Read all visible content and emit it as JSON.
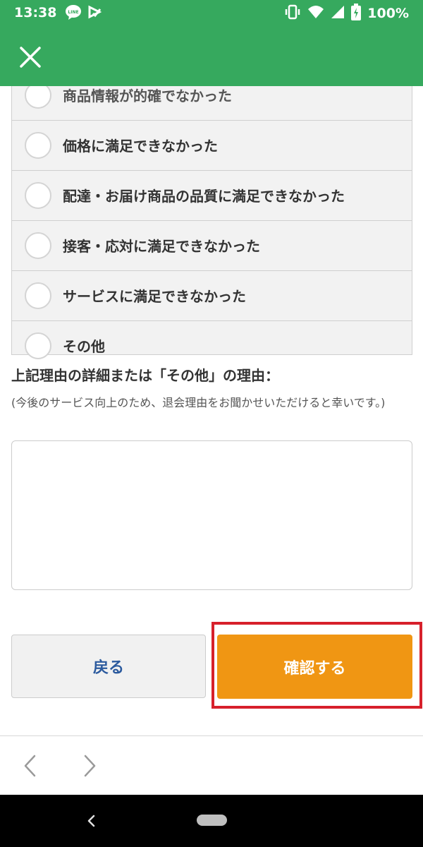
{
  "status_bar": {
    "time": "13:38",
    "battery": "100%",
    "icons": [
      "line-icon",
      "tick-icon",
      "vibrate-icon",
      "wifi-icon",
      "signal-icon",
      "battery-icon"
    ]
  },
  "header": {
    "close_icon": "close-icon",
    "background_color": "#36a95e"
  },
  "form": {
    "options": [
      {
        "label": "商品情報が的確でなかった"
      },
      {
        "label": "価格に満足できなかった"
      },
      {
        "label": "配達・お届け商品の品質に満足できなかった"
      },
      {
        "label": "接客・応対に満足できなかった"
      },
      {
        "label": "サービスに満足できなかった"
      },
      {
        "label": "その他"
      }
    ],
    "detail_heading": "上記理由の詳細または「その他」の理由：",
    "detail_note": "(今後のサービス向上のため、退会理由をお聞かせいただけると幸いです。)",
    "textarea_value": ""
  },
  "actions": {
    "back_label": "戻る",
    "confirm_label": "確認する",
    "confirm_color": "#f09613",
    "highlight_color": "#d7202b"
  },
  "browser": {
    "back_icon": "chevron-left-icon",
    "forward_icon": "chevron-right-icon"
  },
  "system_nav": {
    "back_icon": "nav-back-icon",
    "home_icon": "home-pill-icon"
  }
}
